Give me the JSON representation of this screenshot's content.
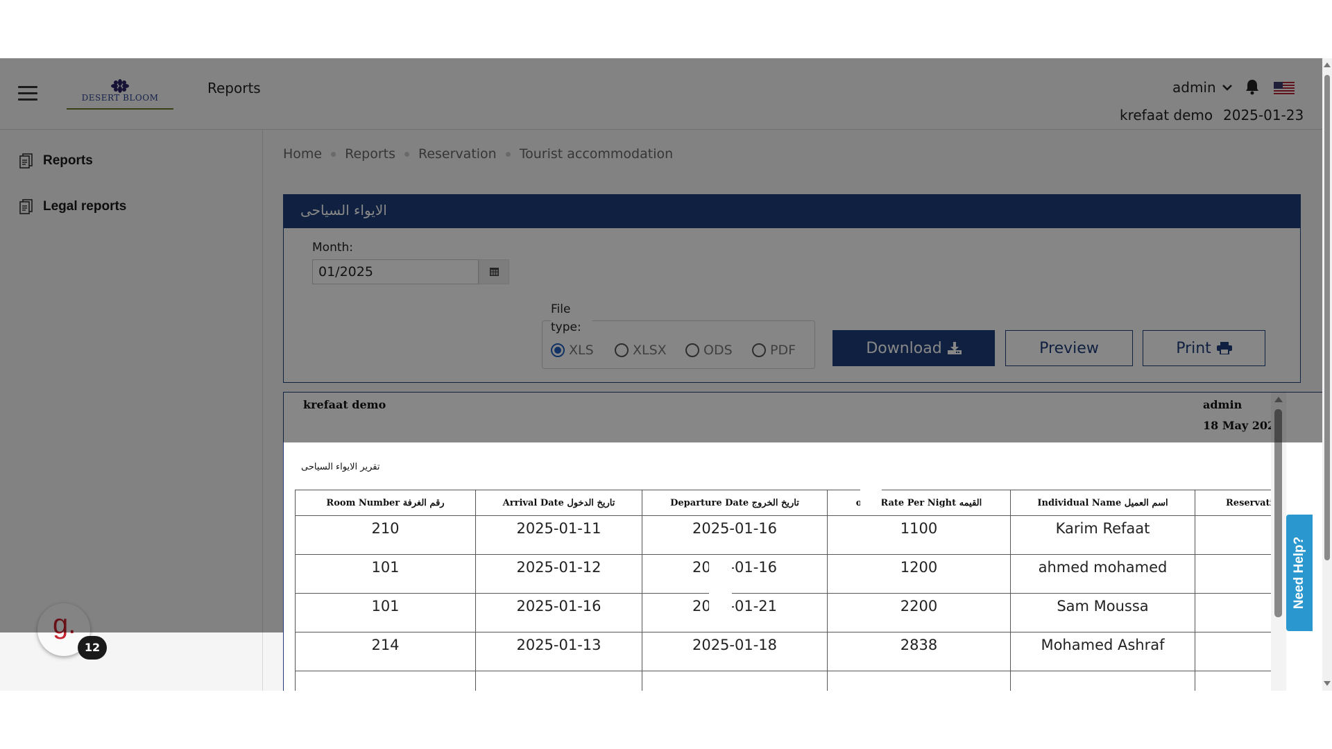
{
  "topbar": {
    "title": "Reports",
    "logo_text": "DESERT BLOOM",
    "user": "admin",
    "company": "krefaat demo",
    "date": "2025-01-23",
    "icons": {
      "menu": "hamburger-icon",
      "notifications": "bell-icon",
      "language": "us-flag-icon"
    }
  },
  "sidebar": {
    "items": [
      {
        "label": "Reports",
        "icon": "report-icon"
      },
      {
        "label": "Legal reports",
        "icon": "report-icon"
      }
    ]
  },
  "badge": {
    "letter": "g.",
    "count": "12"
  },
  "breadcrumb": [
    "Home",
    "Reports",
    "Reservation",
    "Tourist accommodation"
  ],
  "panel": {
    "title": "الايواء السياحى",
    "month_label": "Month:",
    "month_value": "01/2025",
    "file_type_label": "File type:",
    "file_types": [
      "XLS",
      "XLSX",
      "ODS",
      "PDF"
    ],
    "selected_file_type": "XLS",
    "buttons": {
      "download": "Download",
      "preview": "Preview",
      "print": "Print"
    }
  },
  "report": {
    "company": "krefaat demo",
    "user": "admin",
    "date": "18 May 202",
    "subtitle": "تقرير الايواء السياحى",
    "columns": [
      "Room Number رقم الغرفة",
      "Arrival Date تاريخ الدخول",
      "Departure Date تاريخ الخروج",
      "oom Rate Per Night القيمه",
      "Individual Name اسم العميل",
      "Reservati"
    ],
    "rows": [
      [
        "210",
        "2025-01-11",
        "2025-01-16",
        "1100",
        "Karim Refaat",
        ""
      ],
      [
        "101",
        "2025-01-12",
        "2025-01-16",
        "1200",
        "ahmed mohamed",
        ""
      ],
      [
        "101",
        "2025-01-16",
        "2025-01-21",
        "2200",
        "Sam Moussa",
        ""
      ],
      [
        "214",
        "2025-01-13",
        "2025-01-18",
        "2838",
        "Mohamed Ashraf",
        ""
      ]
    ]
  },
  "help": {
    "label": "Need Help?"
  },
  "colors": {
    "primary": "#1f3e7a",
    "help": "#2a98cf",
    "badge_red": "#c4232f"
  }
}
